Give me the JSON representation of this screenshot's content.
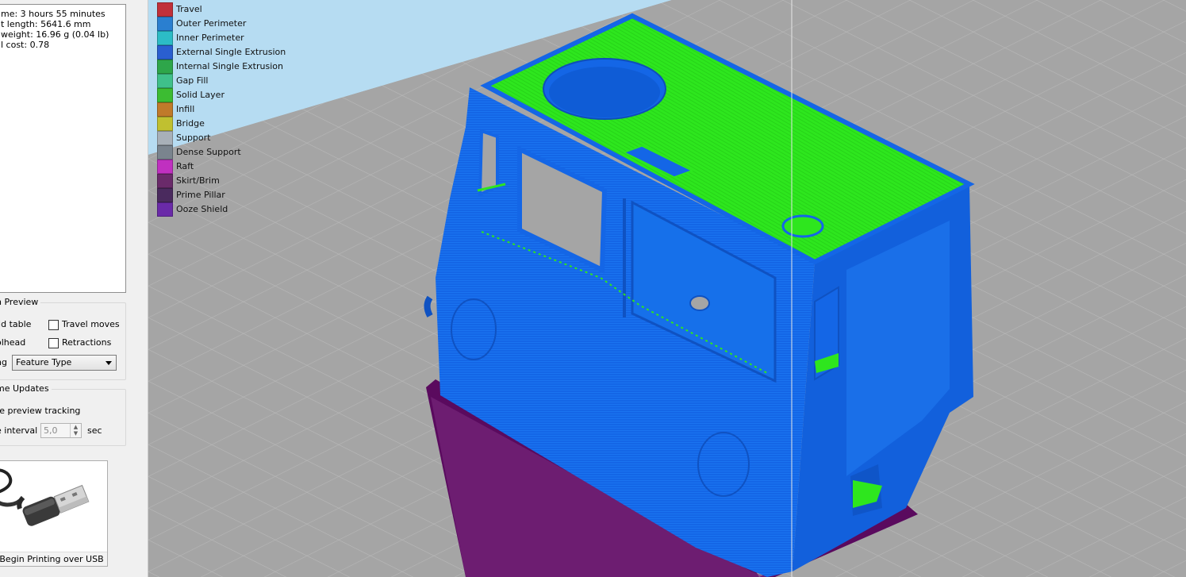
{
  "stats": {
    "lines": [
      "me: 3 hours 55 minutes",
      "t length: 5641.6 mm",
      "weight: 16.96 g (0.04 lb)",
      "l cost: 0.78"
    ]
  },
  "preview": {
    "title": "n Preview",
    "build_table_label": "ild table",
    "travel_moves_label": "Travel moves",
    "toolhead_label": "olhead",
    "retractions_label": "Retractions",
    "coloring_label": "ng",
    "coloring_value": "Feature Type"
  },
  "updates": {
    "title": "me Updates",
    "tracking_label": "re preview tracking",
    "interval_label": "e interval",
    "interval_value": "5,0",
    "interval_unit": "sec"
  },
  "usb": {
    "caption": "Begin Printing over USB"
  },
  "legend": [
    {
      "label": "Travel",
      "color": "#c0303a"
    },
    {
      "label": "Outer Perimeter",
      "color": "#2a7fd0"
    },
    {
      "label": "Inner Perimeter",
      "color": "#2cbcc6"
    },
    {
      "label": "External Single Extrusion",
      "color": "#2a5fd0"
    },
    {
      "label": "Internal Single Extrusion",
      "color": "#2ea64a"
    },
    {
      "label": "Gap Fill",
      "color": "#3fc08a"
    },
    {
      "label": "Solid Layer",
      "color": "#3cbc32"
    },
    {
      "label": "Infill",
      "color": "#c07a2a"
    },
    {
      "label": "Bridge",
      "color": "#c0c030"
    },
    {
      "label": "Support",
      "color": "#a8b0b8"
    },
    {
      "label": "Dense Support",
      "color": "#7a848e"
    },
    {
      "label": "Raft",
      "color": "#c030c0"
    },
    {
      "label": "Skirt/Brim",
      "color": "#6a2a6a"
    },
    {
      "label": "Prime Pillar",
      "color": "#4a2a5e"
    },
    {
      "label": "Ooze Shield",
      "color": "#6a2aa8"
    }
  ],
  "colors": {
    "model_blue": "#1466e6",
    "top_green": "#2ee61e",
    "brim": "#5a0a5e",
    "build_plate": "#a5a5a5",
    "sky": "#b6dcf2"
  }
}
